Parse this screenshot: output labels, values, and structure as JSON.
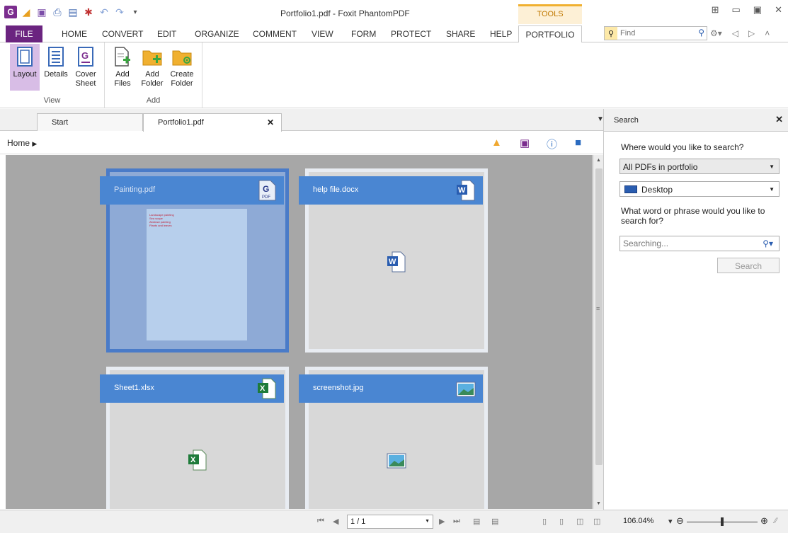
{
  "window": {
    "title": "Portfolio1.pdf - Foxit PhantomPDF",
    "context_tab": "TOOLS"
  },
  "ribbon_tabs": [
    "FILE",
    "HOME",
    "CONVERT",
    "EDIT",
    "ORGANIZE",
    "COMMENT",
    "VIEW",
    "FORM",
    "PROTECT",
    "SHARE",
    "HELP",
    "PORTFOLIO"
  ],
  "active_tab": "PORTFOLIO",
  "find": {
    "placeholder": "Find"
  },
  "ribbon": {
    "view_group": {
      "label": "View",
      "layout": "Layout",
      "details": "Details",
      "cover_sheet": "Cover Sheet"
    },
    "add_group": {
      "label": "Add",
      "add_files": "Add Files",
      "add_folder": "Add Folder",
      "create_folder": "Create Folder"
    }
  },
  "doc_tabs": {
    "start": "Start",
    "portfolio": "Portfolio1.pdf"
  },
  "breadcrumb": {
    "home": "Home"
  },
  "files": [
    {
      "name": "Painting.pdf",
      "type": "pdf",
      "selected": true,
      "preview_lines": [
        "Landscape painting",
        "Sea scape",
        "Abstract painting",
        "Plants and leaves"
      ]
    },
    {
      "name": "help file.docx",
      "type": "word",
      "selected": false
    },
    {
      "name": "Sheet1.xlsx",
      "type": "excel",
      "selected": false
    },
    {
      "name": "screenshot.jpg",
      "type": "image",
      "selected": false
    }
  ],
  "search_panel": {
    "title": "Search",
    "where_label": "Where would you like to search?",
    "scope": "All PDFs in portfolio",
    "location": "Desktop",
    "what_label": "What word or phrase would you like to search for?",
    "input_placeholder": "Searching...",
    "button": "Search"
  },
  "status": {
    "page": "1 / 1",
    "zoom": "106.04%"
  },
  "colors": {
    "accent": "#6b2480",
    "tile_header": "#4a86d2",
    "selected_tile": "#8eaad6",
    "content_bg": "#a7a7a7"
  }
}
